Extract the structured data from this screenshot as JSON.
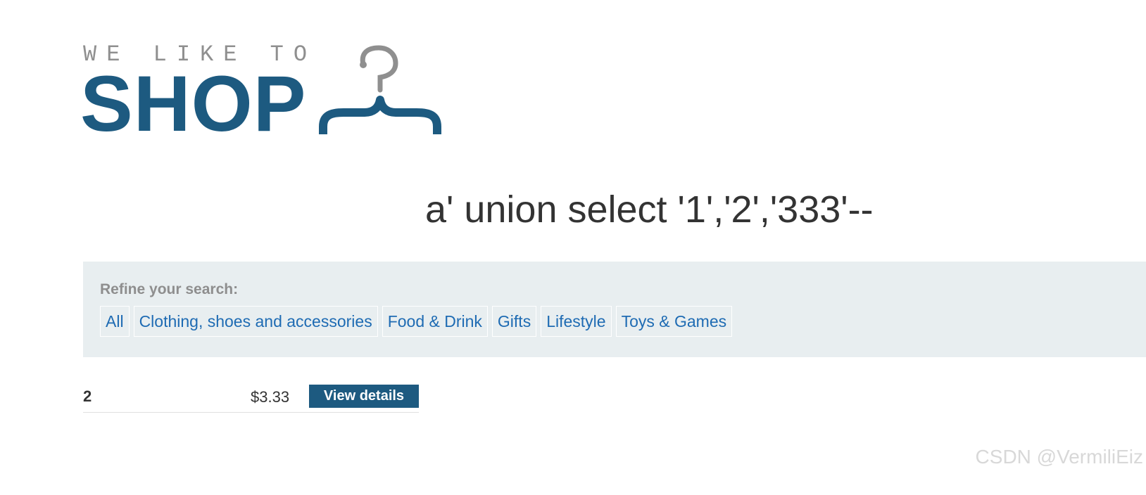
{
  "logo": {
    "tagline": "WE LIKE TO",
    "word": "SHOP",
    "icon": "hanger-icon"
  },
  "search": {
    "heading": "a' union select '1','2','333'--"
  },
  "filters": {
    "label": "Refine your search:",
    "items": [
      {
        "label": "All"
      },
      {
        "label": "Clothing, shoes and accessories"
      },
      {
        "label": "Food & Drink"
      },
      {
        "label": "Gifts"
      },
      {
        "label": "Lifestyle"
      },
      {
        "label": "Toys & Games"
      }
    ]
  },
  "products": [
    {
      "name": "2",
      "price": "$3.33",
      "button_label": "View details"
    }
  ],
  "watermark": "CSDN @VermiliEiz",
  "colors": {
    "brand": "#1d5a80",
    "link": "#1e6bb3",
    "panel": "#e8eef0"
  }
}
